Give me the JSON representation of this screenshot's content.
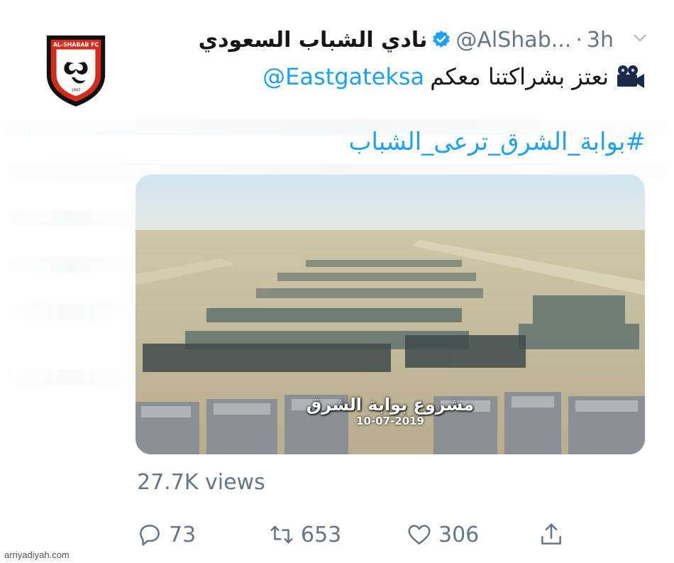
{
  "tweet": {
    "display_name": "نادي الشباب السعودي",
    "handle": "@AlShab...",
    "separator": "·",
    "time": "3h",
    "line1_text": "نعتز بشراكتنا معكم",
    "line1_mention": "@Eastgateksa",
    "hashtag": "#بوابة_الشرق_ترعى_الشباب",
    "camera_icon": "film-camera-icon",
    "avatar_badge": {
      "top_text": "AL-SHABAB FC",
      "year": "1947",
      "colors": {
        "red": "#d52b1e",
        "black": "#111111",
        "white": "#ffffff"
      }
    },
    "media": {
      "caption": "مشروع بوابة الشرق",
      "date": "10-07-2019"
    },
    "views_label": "27.7K views",
    "actions": [
      {
        "icon": "reply-icon",
        "count": "73"
      },
      {
        "icon": "retweet-icon",
        "count": "653"
      },
      {
        "icon": "like-icon",
        "count": "306"
      },
      {
        "icon": "share-icon",
        "count": ""
      }
    ]
  },
  "watermark": "arriyadiyah.com",
  "colors": {
    "link": "#1da1f2",
    "muted": "#657786",
    "text": "#14171a",
    "verified": "#1da1f2"
  }
}
